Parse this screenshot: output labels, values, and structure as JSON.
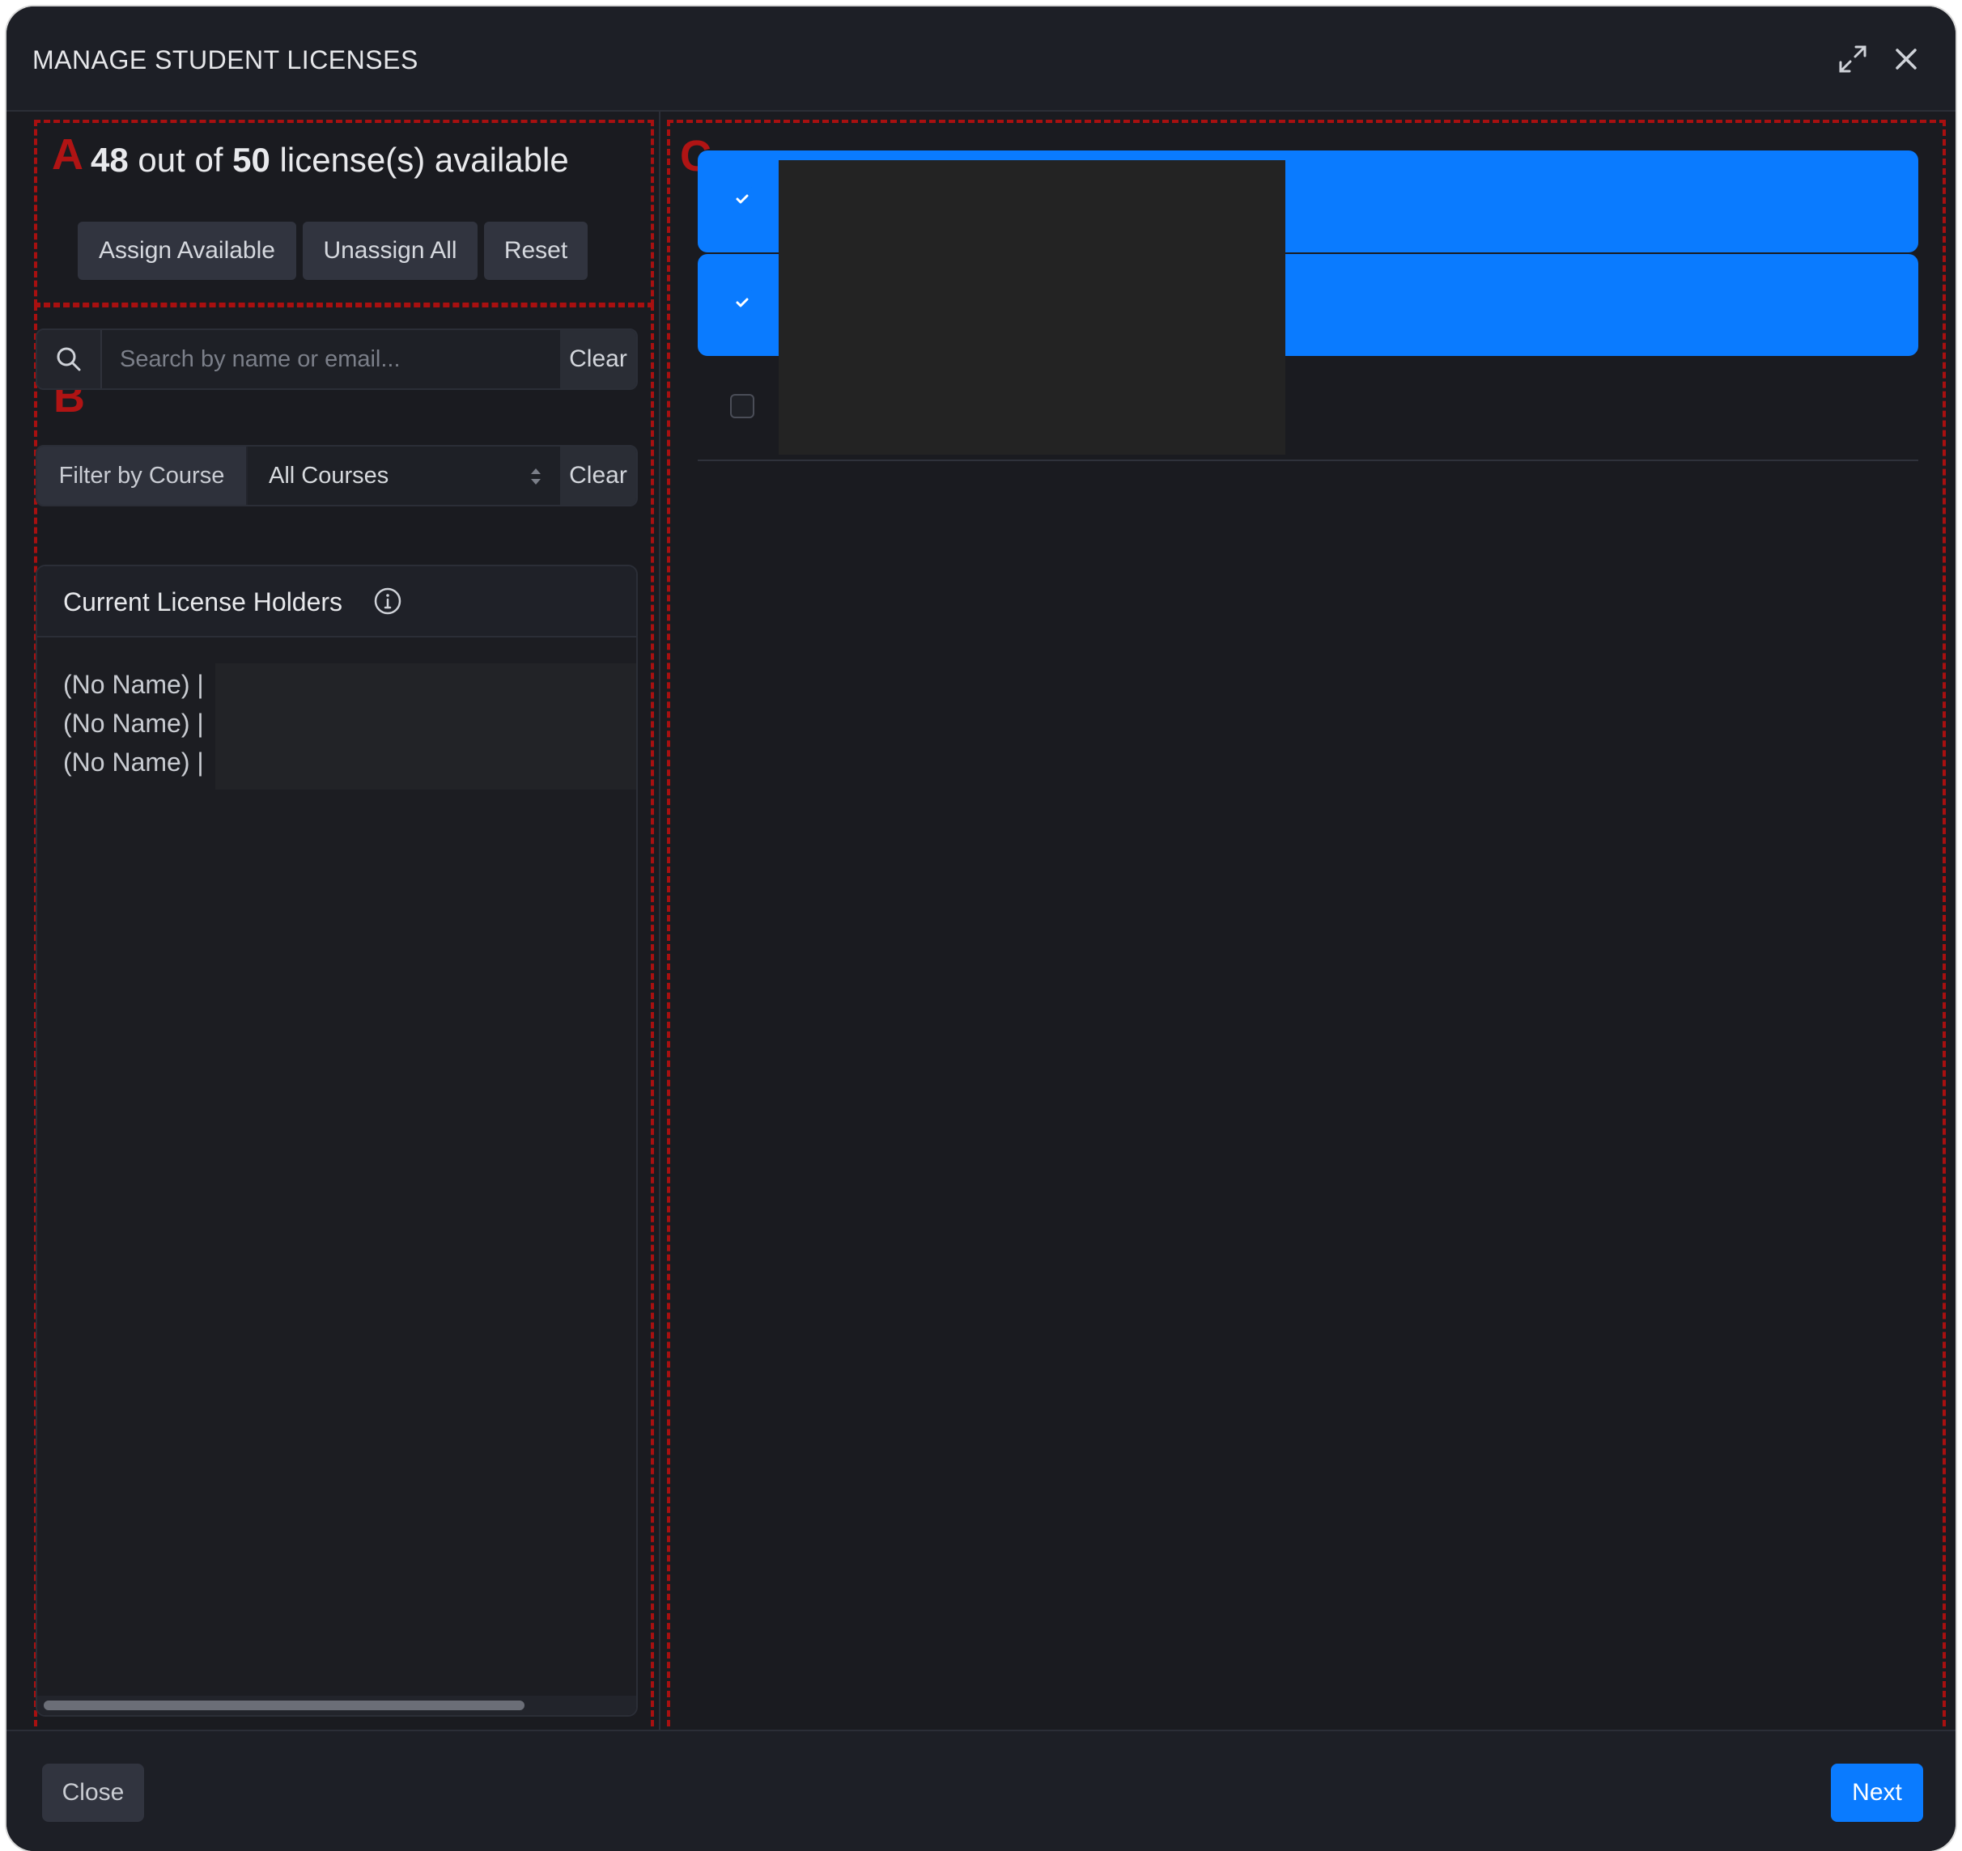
{
  "modal": {
    "title": "MANAGE STUDENT LICENSES",
    "expand_icon": "expand-icon",
    "close_icon": "close-icon"
  },
  "annotations": {
    "region_a": "A",
    "region_b": "B",
    "region_c": "C"
  },
  "licenses": {
    "available": "48",
    "out_of_text": "out of",
    "total": "50",
    "suffix": "license(s) available"
  },
  "actions": {
    "assign_available": "Assign Available",
    "unassign_all": "Unassign All",
    "reset": "Reset"
  },
  "search": {
    "placeholder": "Search by name or email...",
    "value": "",
    "clear_label": "Clear",
    "icon": "search-icon"
  },
  "course_filter": {
    "label": "Filter by Course",
    "selected": "All Courses",
    "clear_label": "Clear"
  },
  "holders": {
    "title": "Current License Holders",
    "info_icon": "info-icon",
    "items": [
      "(No Name) |",
      "(No Name) |",
      "(No Name) |"
    ]
  },
  "student_rows": [
    {
      "checked": true
    },
    {
      "checked": true
    },
    {
      "checked": false
    }
  ],
  "footer": {
    "close_label": "Close",
    "next_label": "Next"
  },
  "colors": {
    "accent": "#0a7bff",
    "background": "#1a1b20",
    "annotation": "#b01414"
  }
}
